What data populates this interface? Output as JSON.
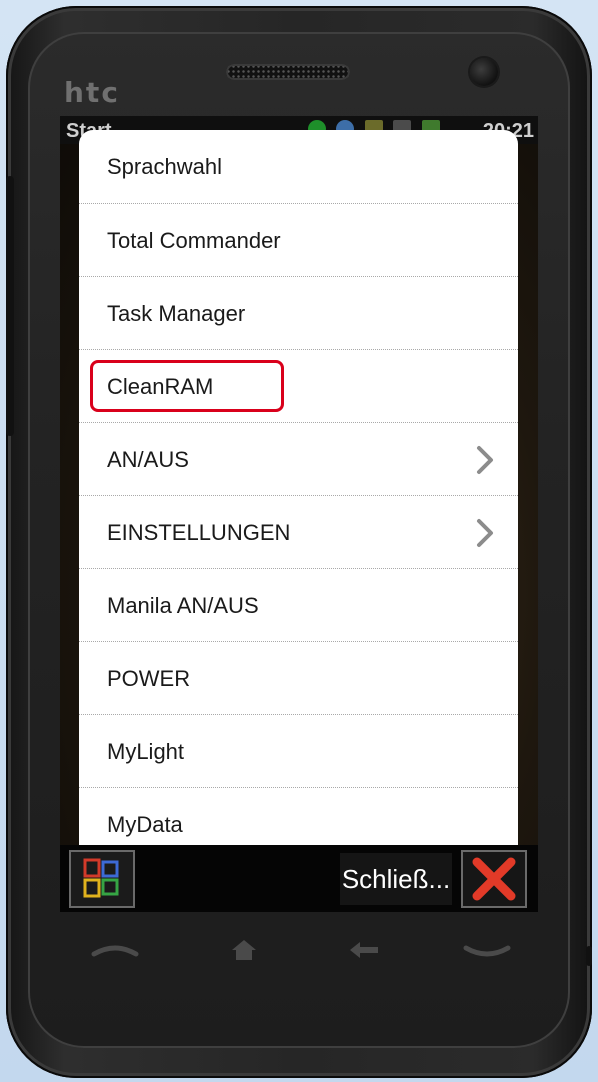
{
  "device": {
    "brand": "htc"
  },
  "statusbar": {
    "title": "Start",
    "time": "20:21"
  },
  "menu": {
    "items": [
      {
        "label": "Sprachwahl",
        "submenu": false
      },
      {
        "label": "Total Commander",
        "submenu": false
      },
      {
        "label": "Task Manager",
        "submenu": false
      },
      {
        "label": "CleanRAM",
        "submenu": false,
        "highlighted": true
      },
      {
        "label": "AN/AUS",
        "submenu": true
      },
      {
        "label": "EINSTELLUNGEN",
        "submenu": true
      },
      {
        "label": "Manila AN/AUS",
        "submenu": false
      },
      {
        "label": "POWER",
        "submenu": false
      },
      {
        "label": "MyLight",
        "submenu": false
      },
      {
        "label": "MyData",
        "submenu": false
      }
    ],
    "highlight_color": "#d9001b"
  },
  "softkeys": {
    "start_icon": "windows-start-icon",
    "close_label": "Schließ...",
    "close_icon": "red-x-icon"
  },
  "hardware_buttons": [
    "call-icon",
    "home-icon",
    "back-icon",
    "end-call-icon"
  ]
}
